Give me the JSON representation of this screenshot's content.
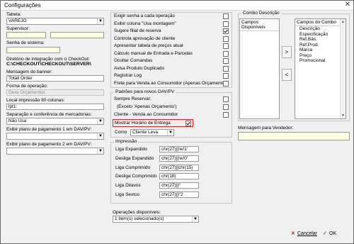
{
  "window": {
    "title": "Configurações",
    "close_glyph": "✕"
  },
  "left": {
    "tabela_label": "Tabela:",
    "tabela_value": "VAREJO",
    "supervisor_label": "Supervisor:",
    "supervisor_value": "",
    "senha_label": "Senha de sistema:",
    "diretorio_label": "Diretório de integração com o CheckOut:",
    "diretorio_value": "C:\\CHECKOUT\\CHECKOUT\\SERVER\\",
    "mensagem_banner_label": "Mensagem do banner:",
    "mensagem_banner_value": "Totall Order",
    "forma_label": "Forma de operação:",
    "forma_value": "Gera Orçamentos",
    "local_label": "Local impressão 80 colunas:",
    "local_value": "lpt1:",
    "separacao_label": "Separação e conferência de mercadorias:",
    "separacao_value": "Não Usa",
    "plano1_label": "Exibir plano de pagamento 1 em DAV/PV:",
    "plano1_value": "",
    "plano2_label": "Exibir plano de pagamento 2 em DAV/PV:",
    "plano2_value": ""
  },
  "checkboxes": [
    {
      "label": "Exigir senha a cada operação",
      "checked": false
    },
    {
      "label": "Exibir coluna \"Usa montagem\"",
      "checked": false
    },
    {
      "label": "Sugere filial de reserva",
      "checked": true
    },
    {
      "label": "Controla aprovação de cliente",
      "checked": false
    },
    {
      "label": "Apresentar tabela de preços atual",
      "checked": false
    },
    {
      "label": "Cálculo manual de Entrada e Parcelas",
      "checked": false
    },
    {
      "label": "Ocultar Comandas",
      "checked": false
    },
    {
      "label": "Avisa Produto Duplicado",
      "checked": false
    },
    {
      "label": "Registrar Log",
      "checked": false
    },
    {
      "label": "Frete para Venda ao Consumidor (Apenas Orçamento)",
      "checked": false
    }
  ],
  "padroes": {
    "title": "Padrões para novos DAV/PV",
    "sempre_reservar": "Sempre Reservar:",
    "exceto": "(Exceto 'Apenas Orçamento')",
    "cliente_venda": "Cliente - Venda ao Consumidor",
    "mostrar_horario": "Mostrar Horário de Entrega",
    "mostrar_horario_checked": true,
    "como_label": "Como",
    "como_value": "Cliente Leva"
  },
  "impressao": {
    "title": "Impressão",
    "rows": [
      {
        "label": "Liga Expandido",
        "value": "chr(27)||!w!1'"
      },
      {
        "label": "Desliga Expandido",
        "value": "chr(27)||!w!0'"
      },
      {
        "label": "Liga Comprimido",
        "value": "chr(27)||chr(15)"
      },
      {
        "label": "Desliga Comprimido",
        "value": "chr(18)"
      },
      {
        "label": "Liga Ditavos",
        "value": "chr(27)||!'"
      },
      {
        "label": "Liga Sextos",
        "value": "chr(27)||!'2"
      }
    ]
  },
  "operacoes": {
    "label": "Operações disponíveis:",
    "value": "1 item(s) selecionado(s)"
  },
  "combo_descricao": {
    "title": "Combo Descrição",
    "disponiveis_header": "Campos Disponíveis",
    "combo_header": "Campos do Combo",
    "combo_items": [
      "Descrição",
      "Especificação",
      "Ref.Bás.",
      "Ref.Prod.",
      "Marca",
      "Preço",
      "Promocional"
    ],
    "move_right": ">",
    "move_left": "<"
  },
  "mensagem_vendedor": {
    "label": "Mensagem para Vendedor:",
    "value": ""
  },
  "buttons": {
    "cancelar": "Cancelar",
    "ok": "OK",
    "cancel_icon": "✕",
    "ok_icon": "✓"
  },
  "colors": {
    "highlight_border": "#e02020",
    "check_mark": "#1a1a1a",
    "cancel_icon": "#cc1f1f",
    "ok_icon": "#2a9a2a"
  }
}
